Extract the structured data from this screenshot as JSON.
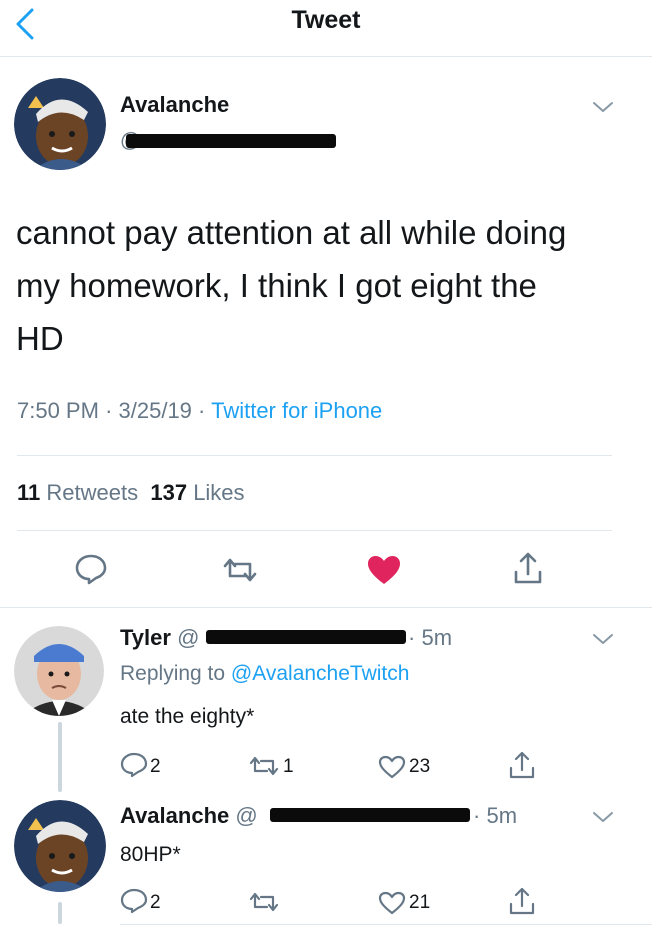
{
  "nav": {
    "title": "Tweet"
  },
  "tweet": {
    "author": "Avalanche",
    "handle_prefix": "@",
    "text_lines": [
      "cannot pay attention at all while doing",
      "my homework, I think I got eight the",
      "HD"
    ],
    "time": "7:50 PM",
    "date": "3/25/19",
    "source": "Twitter for iPhone",
    "retweets_count": "11",
    "retweets_label": "Retweets",
    "likes_count": "137",
    "likes_label": "Likes",
    "liked": true
  },
  "replies": [
    {
      "author": "Tyler",
      "handle_prefix": "@",
      "age": "5m",
      "replying_label": "Replying to",
      "replying_to": "@AvalancheTwitch",
      "text": "ate the eighty*",
      "reply_count": "2",
      "retweet_count": "1",
      "like_count": "23"
    },
    {
      "author": "Avalanche",
      "handle_prefix": "@",
      "age": "5m",
      "text": "80HP*",
      "reply_count": "2",
      "like_count": "21"
    }
  ],
  "colors": {
    "accent": "#1da1f2",
    "like": "#e0245e",
    "muted": "#657786",
    "text": "#14171a"
  }
}
